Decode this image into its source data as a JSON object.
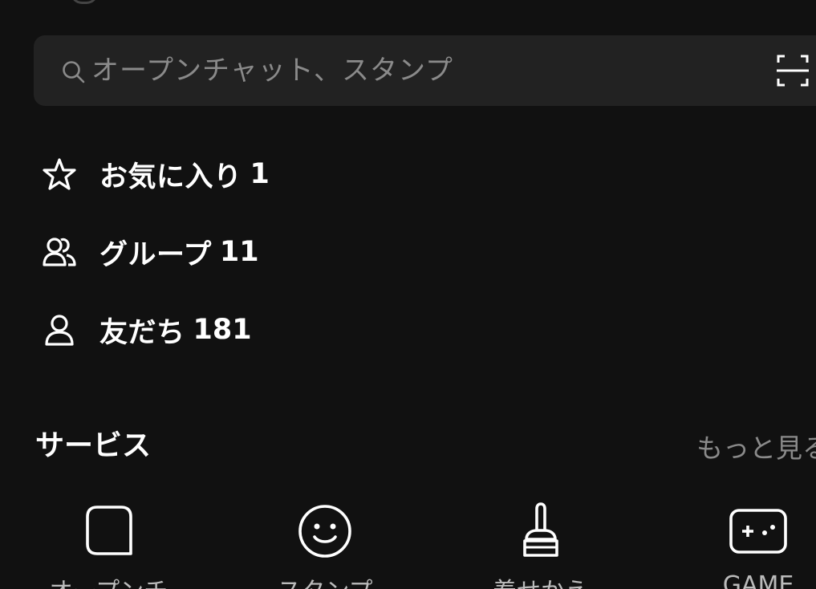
{
  "search": {
    "placeholder": "オープンチャット、スタンプ",
    "icon": "search-icon",
    "scan_icon": "qr-scan-icon"
  },
  "lists": [
    {
      "label": "お気に入り",
      "count": "1",
      "icon": "star-icon"
    },
    {
      "label": "グループ",
      "count": "11",
      "icon": "group-icon"
    },
    {
      "label": "友だち",
      "count": "181",
      "icon": "person-icon"
    }
  ],
  "services": {
    "title": "サービス",
    "more": "もっと見る",
    "items": [
      {
        "label": "オープンチ",
        "icon": "openchat-icon"
      },
      {
        "label": "スタンプ",
        "icon": "smile-icon"
      },
      {
        "label": "着せかえ",
        "icon": "brush-icon"
      },
      {
        "label": "GAME",
        "icon": "gamepad-icon"
      }
    ]
  },
  "colors": {
    "background": "#111111",
    "search_bg": "#222222",
    "text_primary": "#ffffff",
    "text_secondary": "#8a8a8a"
  }
}
